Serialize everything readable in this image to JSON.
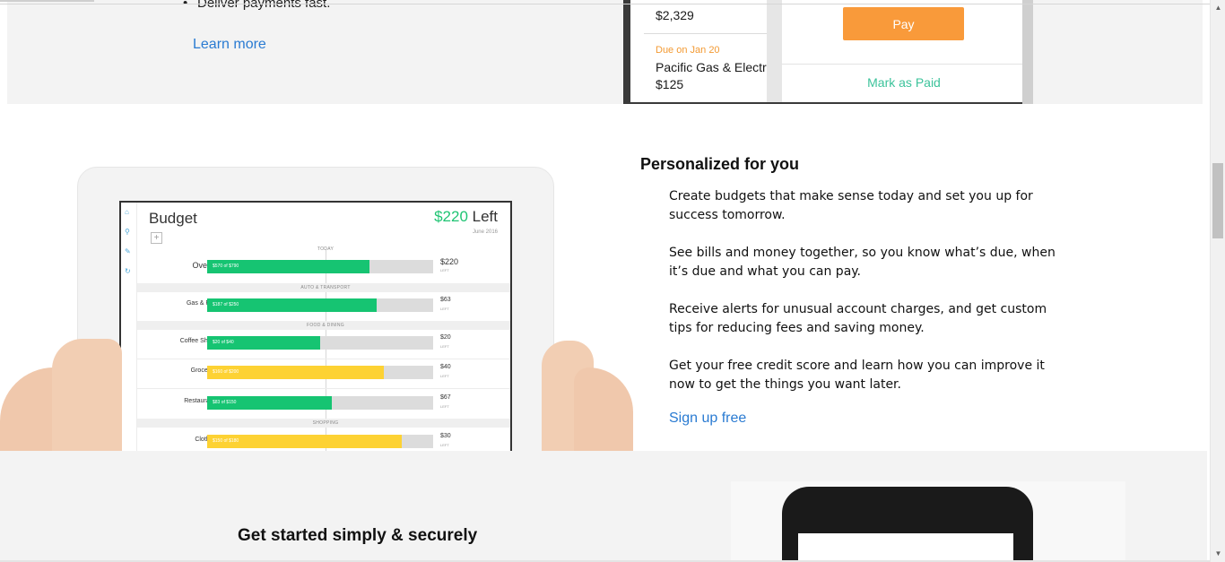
{
  "bills_section": {
    "bullet_text": "Deliver payments fast.",
    "learn_more_label": "Learn more",
    "phone": {
      "first_amount": "$2,329",
      "due_label": "Due on Jan 20",
      "payee": "Pacific Gas & Electric",
      "payee_amount": "$125",
      "pay_button_label": "Pay",
      "mark_paid_label": "Mark as Paid"
    }
  },
  "personalized_section": {
    "heading": "Personalized for you",
    "paragraphs": [
      "Create budgets that make sense today and set you up for success tomorrow.",
      "See bills and money together, so you know what’s due, when it’s due and what you can pay.",
      "Receive alerts for unusual account charges, and get custom tips for reducing fees and saving money.",
      "Get your free credit score and learn how you can improve it now to get the things you want later."
    ],
    "signup_label": "Sign up free",
    "tablet": {
      "title": "Budget",
      "left_amount": "$220",
      "left_word": "Left",
      "month": "June 2016",
      "sections": {
        "today": "TODAY",
        "auto": "AUTO & TRANSPORT",
        "food": "FOOD & DINING",
        "shopping": "SHOPPING"
      },
      "rows": [
        {
          "label": "Overall",
          "bar_text": "$570 of $790",
          "value": "$220",
          "left_text": "LEFT",
          "fraction": 0.72,
          "color": "#16c472"
        },
        {
          "label": "Gas & Fuel",
          "bar_text": "$187 of $250",
          "value": "$63",
          "left_text": "LEFT",
          "fraction": 0.75,
          "color": "#16c472"
        },
        {
          "label": "Coffee Shops",
          "bar_text": "$20 of $40",
          "value": "$20",
          "left_text": "LEFT",
          "fraction": 0.5,
          "color": "#16c472"
        },
        {
          "label": "Groceries",
          "bar_text": "$160 of $200",
          "value": "$40",
          "left_text": "LEFT",
          "fraction": 0.78,
          "color": "#fdd233"
        },
        {
          "label": "Restaurants",
          "bar_text": "$83 of $150",
          "value": "$67",
          "left_text": "LEFT",
          "fraction": 0.55,
          "color": "#16c472"
        },
        {
          "label": "Clothing",
          "bar_text": "$150 of $180",
          "value": "$30",
          "left_text": "LEFT",
          "fraction": 0.86,
          "color": "#fdd233"
        }
      ],
      "side_icons": [
        "home-icon",
        "search-icon",
        "edit-icon",
        "refresh-icon"
      ]
    }
  },
  "get_started_section": {
    "heading": "Get started simply & securely"
  },
  "colors": {
    "link": "#2a7bd2",
    "accent_green": "#16c472",
    "pay_orange": "#f99a3a",
    "mark_paid_green": "#3cc39b"
  }
}
